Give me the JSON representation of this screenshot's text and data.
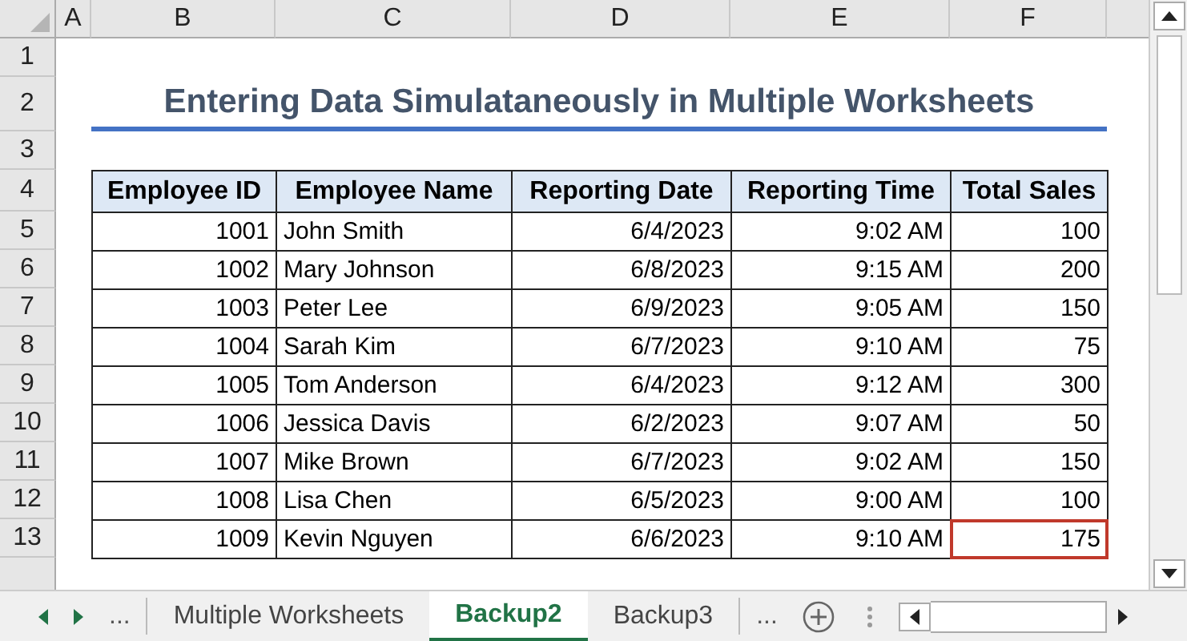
{
  "column_headers": [
    "A",
    "B",
    "C",
    "D",
    "E",
    "F"
  ],
  "row_numbers": [
    "1",
    "2",
    "3",
    "4",
    "5",
    "6",
    "7",
    "8",
    "9",
    "10",
    "11",
    "12",
    "13"
  ],
  "title": "Entering Data Simulataneously in Multiple Worksheets",
  "table": {
    "columns": [
      "Employee ID",
      "Employee Name",
      "Reporting Date",
      "Reporting Time",
      "Total Sales"
    ],
    "rows": [
      {
        "cells": [
          {
            "text": "1001",
            "selected": false
          },
          {
            "text": "John Smith",
            "selected": false
          },
          {
            "text": "6/4/2023",
            "selected": false
          },
          {
            "text": "9:02 AM",
            "selected": false
          },
          {
            "text": "100",
            "selected": false
          }
        ]
      },
      {
        "cells": [
          {
            "text": "1002",
            "selected": false
          },
          {
            "text": "Mary Johnson",
            "selected": false
          },
          {
            "text": "6/8/2023",
            "selected": false
          },
          {
            "text": "9:15 AM",
            "selected": false
          },
          {
            "text": "200",
            "selected": false
          }
        ]
      },
      {
        "cells": [
          {
            "text": "1003",
            "selected": false
          },
          {
            "text": "Peter Lee",
            "selected": false
          },
          {
            "text": "6/9/2023",
            "selected": false
          },
          {
            "text": "9:05 AM",
            "selected": false
          },
          {
            "text": "150",
            "selected": false
          }
        ]
      },
      {
        "cells": [
          {
            "text": "1004",
            "selected": false
          },
          {
            "text": "Sarah Kim",
            "selected": false
          },
          {
            "text": "6/7/2023",
            "selected": false
          },
          {
            "text": "9:10 AM",
            "selected": false
          },
          {
            "text": "75",
            "selected": false
          }
        ]
      },
      {
        "cells": [
          {
            "text": "1005",
            "selected": false
          },
          {
            "text": "Tom Anderson",
            "selected": false
          },
          {
            "text": "6/4/2023",
            "selected": false
          },
          {
            "text": "9:12 AM",
            "selected": false
          },
          {
            "text": "300",
            "selected": false
          }
        ]
      },
      {
        "cells": [
          {
            "text": "1006",
            "selected": false
          },
          {
            "text": "Jessica Davis",
            "selected": false
          },
          {
            "text": "6/2/2023",
            "selected": false
          },
          {
            "text": "9:07 AM",
            "selected": false
          },
          {
            "text": "50",
            "selected": false
          }
        ]
      },
      {
        "cells": [
          {
            "text": "1007",
            "selected": false
          },
          {
            "text": "Mike Brown",
            "selected": false
          },
          {
            "text": "6/7/2023",
            "selected": false
          },
          {
            "text": "9:02 AM",
            "selected": false
          },
          {
            "text": "150",
            "selected": false
          }
        ]
      },
      {
        "cells": [
          {
            "text": "1008",
            "selected": false
          },
          {
            "text": "Lisa Chen",
            "selected": false
          },
          {
            "text": "6/5/2023",
            "selected": false
          },
          {
            "text": "9:00 AM",
            "selected": false
          },
          {
            "text": "100",
            "selected": false
          }
        ]
      },
      {
        "cells": [
          {
            "text": "1009",
            "selected": false
          },
          {
            "text": "Kevin Nguyen",
            "selected": false
          },
          {
            "text": "6/6/2023",
            "selected": false
          },
          {
            "text": "9:10 AM",
            "selected": false
          },
          {
            "text": "175",
            "selected": true
          }
        ]
      }
    ]
  },
  "sheet_tabs": {
    "nav_more": "...",
    "tabs": [
      {
        "label": "Multiple Worksheets",
        "selected": false
      },
      {
        "label": "Backup2",
        "selected": true
      },
      {
        "label": "Backup3",
        "selected": false
      }
    ],
    "more": "..."
  }
}
